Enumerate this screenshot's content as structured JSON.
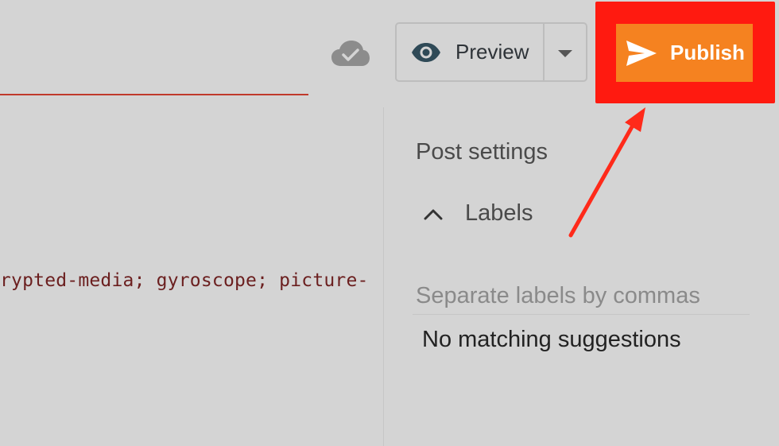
{
  "editor": {
    "code_text": "rypted-media; gyroscope; picture-"
  },
  "toolbar": {
    "sync_icon": "cloud-check-icon",
    "preview_label": "Preview",
    "preview_icon": "eye-icon",
    "dropdown_icon": "caret-down-icon",
    "publish_label": "Publish",
    "publish_icon": "send-icon"
  },
  "post_settings": {
    "title": "Post settings",
    "labels_section": {
      "label": "Labels",
      "toggle_icon": "chevron-up-icon",
      "input_placeholder": "Separate labels by commas",
      "input_value": "",
      "suggestions_text": "No matching suggestions"
    }
  },
  "colors": {
    "background": "#d4d4d4",
    "publish_button": "#f58220",
    "highlight": "#ff1a10",
    "annotation_arrow": "#ff2a1a",
    "code_text": "#6b1f1f",
    "editor_underline": "#c0392b"
  }
}
